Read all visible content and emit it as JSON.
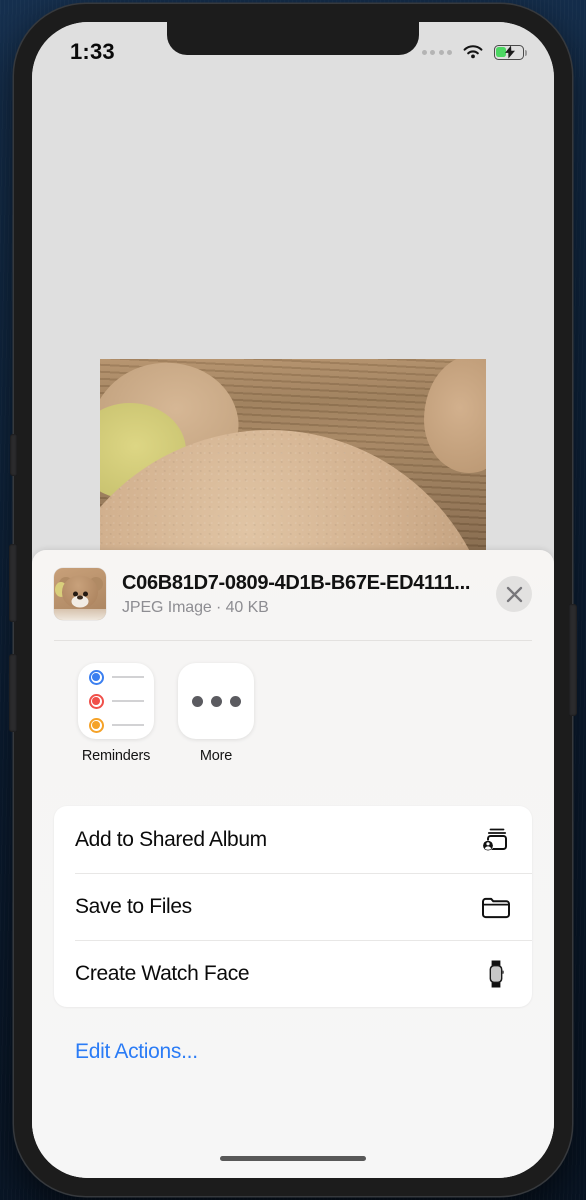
{
  "wallpaper_color": "#0d1b2e",
  "status_bar": {
    "time": "1:33",
    "signal_icon": "signal-dots-icon",
    "wifi_icon": "wifi-icon",
    "battery_icon": "battery-charging-icon",
    "battery_level_pct": 36
  },
  "preview": {
    "photo_alt": "teddy-bear-photo"
  },
  "share_sheet": {
    "file": {
      "name": "C06B81D7-0809-4D1B-B67E-ED4111...",
      "subtitle": "JPEG Image · 40 KB",
      "type": "JPEG Image",
      "size": "40 KB",
      "thumbnail_icon": "file-thumbnail"
    },
    "close_label": "Close",
    "close_icon": "close-icon",
    "apps": [
      {
        "label": "Reminders",
        "icon": "reminders-icon"
      },
      {
        "label": "More",
        "icon": "more-icon"
      }
    ],
    "actions": [
      {
        "label": "Add to Shared Album",
        "icon": "shared-album-icon"
      },
      {
        "label": "Save to Files",
        "icon": "folder-icon"
      },
      {
        "label": "Create Watch Face",
        "icon": "apple-watch-icon"
      }
    ],
    "edit_actions_label": "Edit Actions...",
    "accent_color": "#2b7cf6"
  }
}
